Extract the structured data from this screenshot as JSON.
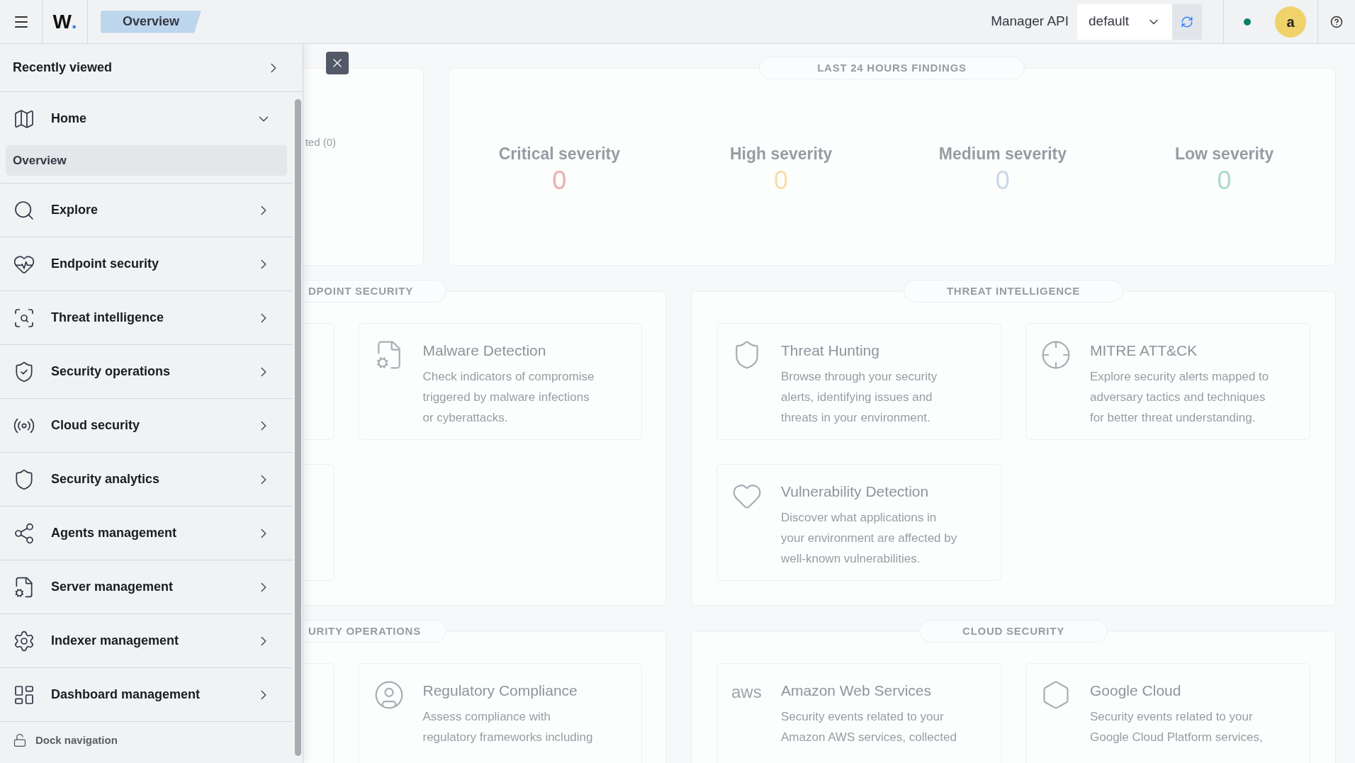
{
  "topbar": {
    "logo": {
      "letter": "W",
      "mark": "."
    },
    "breadcrumb": {
      "label": "Overview"
    },
    "api_label": "Manager API",
    "api_select": {
      "value": "default"
    },
    "status": {
      "connected": true
    },
    "avatar": {
      "initial": "a"
    }
  },
  "sidebar": {
    "recently_viewed": {
      "label": "Recently viewed"
    },
    "items": [
      {
        "label": "Home",
        "expanded": true,
        "children": [
          {
            "label": "Overview",
            "selected": true
          }
        ]
      },
      {
        "label": "Explore",
        "expanded": false
      },
      {
        "label": "Endpoint security",
        "expanded": false
      },
      {
        "label": "Threat intelligence",
        "expanded": false
      },
      {
        "label": "Security operations",
        "expanded": false
      },
      {
        "label": "Cloud security",
        "expanded": false
      },
      {
        "label": "Security analytics",
        "expanded": false
      },
      {
        "label": "Agents management",
        "expanded": false
      },
      {
        "label": "Server management",
        "expanded": false
      },
      {
        "label": "Indexer management",
        "expanded": false
      },
      {
        "label": "Dashboard management",
        "expanded": false
      }
    ],
    "dock": {
      "label": "Dock navigation"
    }
  },
  "summary_card": {
    "partial_text": "ted (0)"
  },
  "findings": {
    "title": "LAST 24 HOURS FINDINGS",
    "severities": [
      {
        "label": "Critical severity",
        "count": "0",
        "color": "#eab0ab"
      },
      {
        "label": "High severity",
        "count": "0",
        "color": "#f6e0a8"
      },
      {
        "label": "Medium severity",
        "count": "0",
        "color": "#cad9e8"
      },
      {
        "label": "Low severity",
        "count": "0",
        "color": "#acd9cf"
      }
    ]
  },
  "sections": [
    {
      "title": "DPOINT SECURITY",
      "cards": [
        {
          "kind": "covered"
        },
        {
          "kind": "module",
          "title": "Malware Detection",
          "description": "Check indicators of compromise\ntriggered by malware infections\nor cyberattacks."
        },
        {
          "kind": "covered"
        }
      ]
    },
    {
      "title": "THREAT INTELLIGENCE",
      "cards": [
        {
          "kind": "module",
          "title": "Threat Hunting",
          "description": "Browse through your security\nalerts, identifying issues and\nthreats in your environment."
        },
        {
          "kind": "module",
          "title": "MITRE ATT&CK",
          "description": "Explore security alerts mapped to\nadversary tactics and techniques\nfor better threat understanding."
        },
        {
          "kind": "module",
          "title": "Vulnerability Detection",
          "description": "Discover what applications in\nyour environment are affected by\nwell-known vulnerabilities."
        }
      ]
    },
    {
      "title": "URITY OPERATIONS",
      "cards": [
        {
          "kind": "covered"
        },
        {
          "kind": "module",
          "title": "Regulatory Compliance",
          "description": "Assess compliance with\nregulatory frameworks including"
        }
      ]
    },
    {
      "title": "CLOUD SECURITY",
      "cards": [
        {
          "kind": "module",
          "logo_text": "aws",
          "title": "Amazon Web Services",
          "description": "Security events related to your\nAmazon AWS services, collected"
        },
        {
          "kind": "module",
          "title": "Google Cloud",
          "description": "Security events related to your\nGoogle Cloud Platform services,"
        }
      ]
    }
  ]
}
